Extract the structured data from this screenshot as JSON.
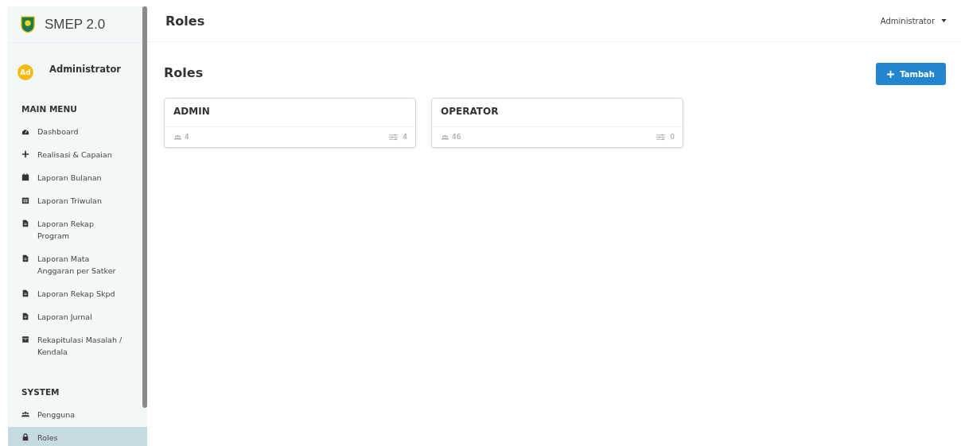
{
  "app": {
    "name": "SMEP 2.0"
  },
  "user": {
    "initials": "Ad",
    "name": "Administrator"
  },
  "menu_sections": [
    {
      "title": "MAIN MENU",
      "items": [
        {
          "label": "Dashboard",
          "selected": false
        },
        {
          "label": "Realisasi & Capaian",
          "selected": false
        },
        {
          "label": "Laporan Bulanan",
          "selected": false
        },
        {
          "label": "Laporan Triwulan",
          "selected": false
        },
        {
          "label": "Laporan Rekap Program",
          "selected": false
        },
        {
          "label": "Laporan Mata Anggaran per Satker",
          "selected": false
        },
        {
          "label": "Laporan Rekap Skpd",
          "selected": false
        },
        {
          "label": "Laporan Jurnal",
          "selected": false
        },
        {
          "label": "Rekapitulasi Masalah / Kendala",
          "selected": false
        }
      ]
    },
    {
      "title": "SYSTEM",
      "items": [
        {
          "label": "Pengguna",
          "selected": false
        },
        {
          "label": "Roles",
          "selected": true
        }
      ]
    }
  ],
  "header": {
    "title": "Roles",
    "user_menu": "Administrator"
  },
  "page": {
    "title": "Roles",
    "add_button": "Tambah"
  },
  "roles": [
    {
      "name": "ADMIN",
      "users": "4",
      "permissions": "4"
    },
    {
      "name": "OPERATOR",
      "users": "46",
      "permissions": "0"
    }
  ]
}
